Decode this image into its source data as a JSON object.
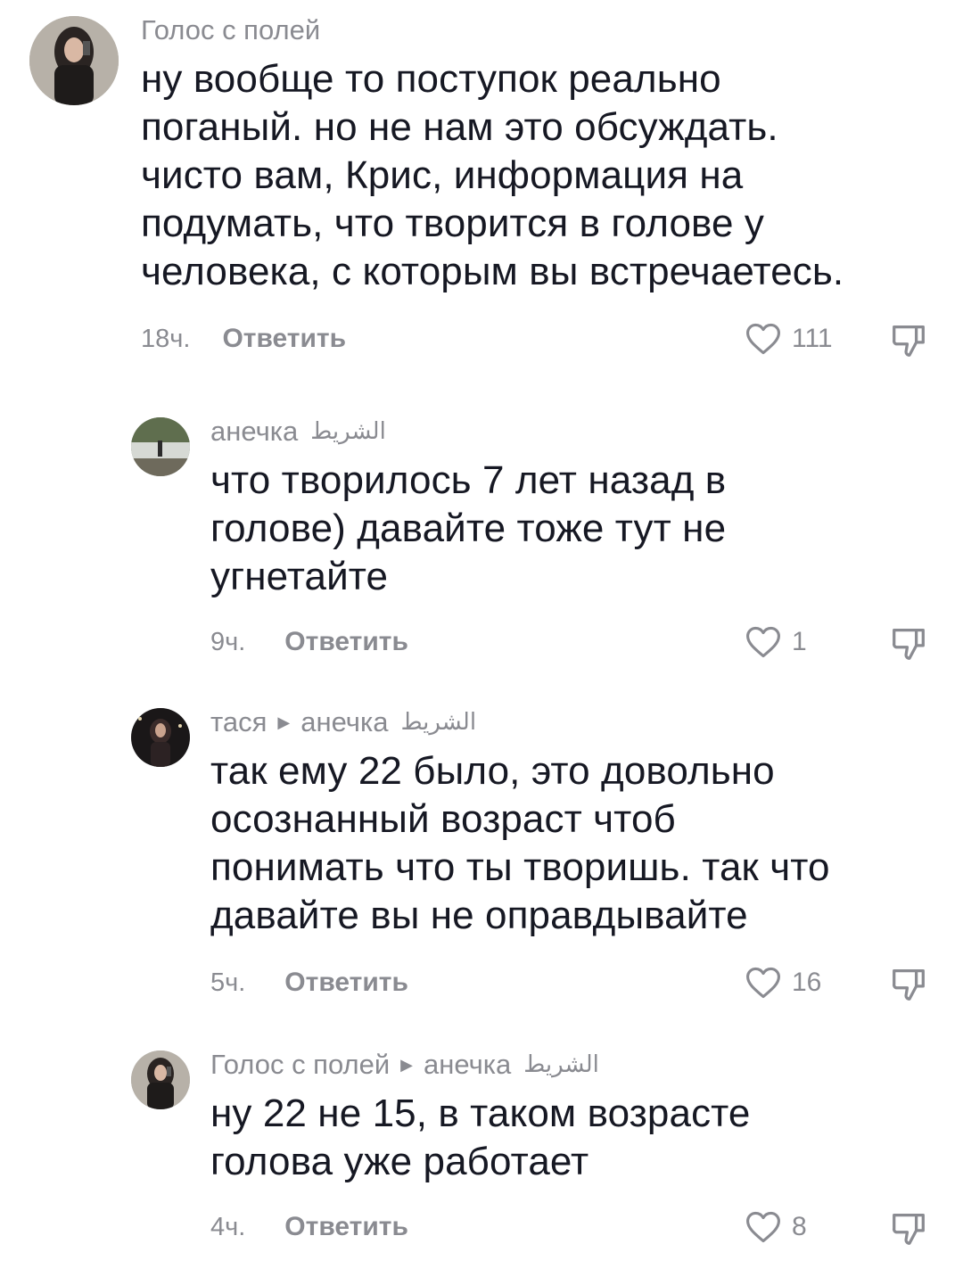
{
  "comments": [
    {
      "author": "Голос с полей",
      "reply_to": "",
      "badge": "",
      "text": "ну вообще то поступок реально\nпоганый. но не нам это обсуждать.\nчисто вам, Крис, информация на\nподумать, что творится в голове у\nчеловека, с которым вы встречаетесь.",
      "time": "18ч.",
      "reply_label": "Ответить",
      "likes": "111"
    },
    {
      "author": "анечка",
      "reply_to": "",
      "badge": "الشريط",
      "text": "что творилось 7 лет назад в\nголове) давайте тоже тут не\nугнетайте",
      "time": "9ч.",
      "reply_label": "Ответить",
      "likes": "1"
    },
    {
      "author": "тася",
      "reply_to": "анечка",
      "badge": "الشريط",
      "text": "так ему 22 было, это довольно\nосознанный возраст чтоб\nпонимать что ты творишь. так что\nдавайте вы не оправдывайте",
      "time": "5ч.",
      "reply_label": "Ответить",
      "likes": "16"
    },
    {
      "author": "Голос с полей",
      "reply_to": "анечка",
      "badge": "الشريط",
      "text": "ну 22 не 15, в таком возрасте\nголова уже работает",
      "time": "4ч.",
      "reply_label": "Ответить",
      "likes": "8"
    }
  ],
  "icons": {
    "like": "heart-outline-icon",
    "dislike": "thumbs-down-outline-icon",
    "reply_arrow": "triangle-right-icon"
  },
  "colors": {
    "text": "#161823",
    "muted": "#8a8b91",
    "background": "#ffffff"
  }
}
